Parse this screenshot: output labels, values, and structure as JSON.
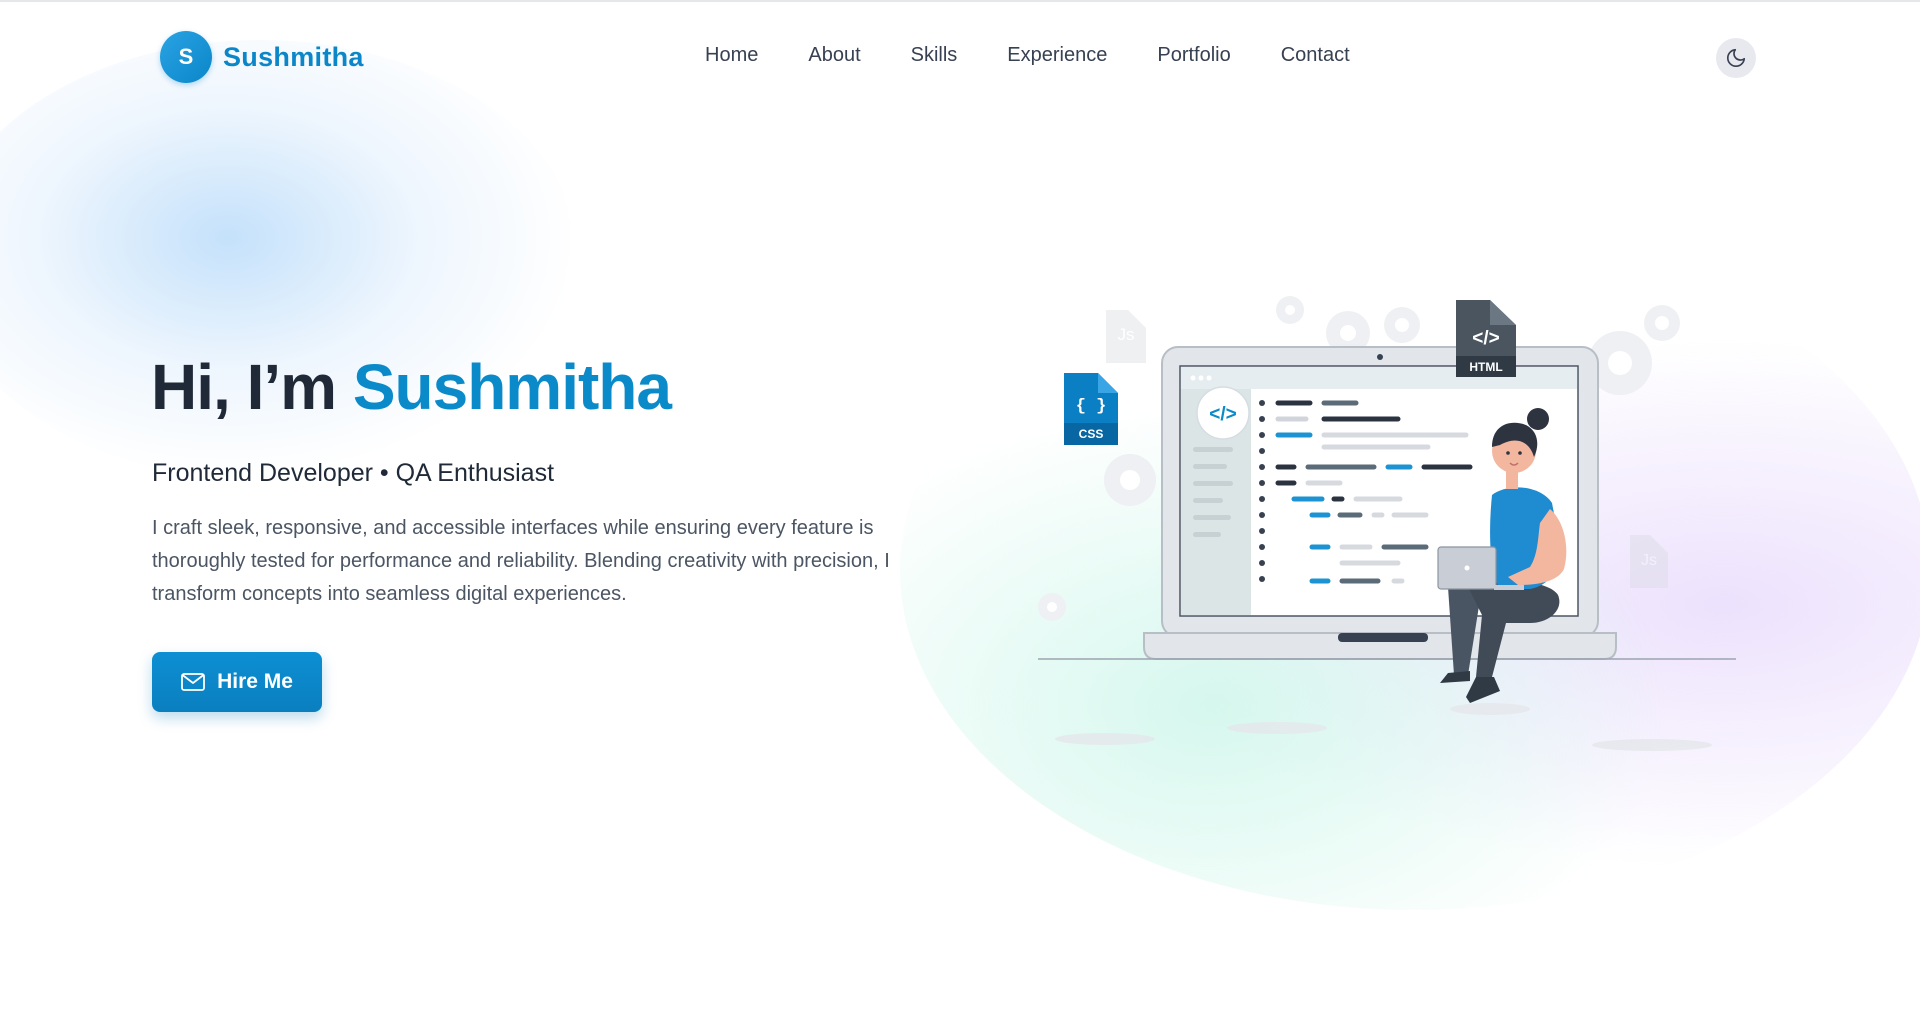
{
  "brand": {
    "initial": "S",
    "name": "Sushmitha",
    "accent_color": "#0b87c9"
  },
  "nav": {
    "links": [
      "Home",
      "About",
      "Skills",
      "Experience",
      "Portfolio",
      "Contact"
    ],
    "theme_toggle_icon": "moon-icon"
  },
  "hero": {
    "greeting": "Hi, I’m",
    "name": "Sushmitha",
    "subtitle": "Frontend Developer • QA Enthusiast",
    "description": "I craft sleek, responsive, and accessible interfaces while ensuring every feature is thoroughly tested for performance and reliability. Blending creativity with precision, I transform concepts into seamless digital experiences.",
    "cta": {
      "label": "Hire Me",
      "icon": "mail-icon"
    }
  },
  "illustration": {
    "file_badges": {
      "css": "CSS",
      "html": "HTML",
      "js": "Js"
    },
    "code_icon": "</>",
    "css_glyph": "{ }"
  }
}
